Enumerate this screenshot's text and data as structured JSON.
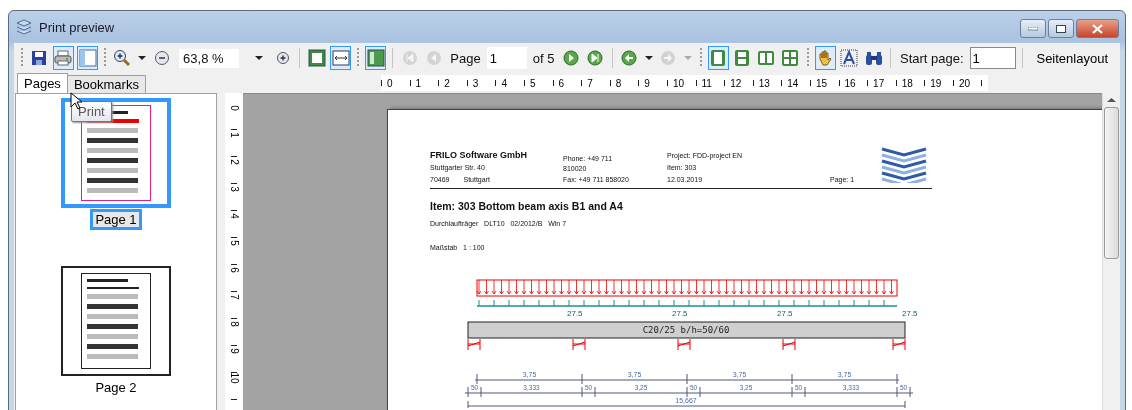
{
  "window": {
    "title": "Print preview"
  },
  "toolbar": [
    {
      "kind": "grip"
    },
    {
      "kind": "button",
      "selected": false,
      "disabled": false
    },
    {
      "kind": "button",
      "selected": true,
      "disabled": false
    },
    {
      "kind": "button",
      "selected": true,
      "disabled": false
    },
    {
      "kind": "grip"
    },
    {
      "kind": "button",
      "selected": false,
      "disabled": false
    },
    {
      "kind": "caret",
      "disabled": false
    },
    {
      "kind": "button",
      "selected": false,
      "disabled": false
    },
    {
      "kind": "combo",
      "value": "63,8 %"
    },
    {
      "kind": "button",
      "selected": false,
      "disabled": false
    },
    {
      "kind": "sep"
    },
    {
      "kind": "button",
      "selected": false,
      "disabled": false
    },
    {
      "kind": "button",
      "selected": true,
      "disabled": false
    },
    {
      "kind": "grip"
    },
    {
      "kind": "button",
      "selected": true,
      "disabled": false
    },
    {
      "kind": "sep"
    },
    {
      "kind": "button",
      "selected": false,
      "disabled": true
    },
    {
      "kind": "button",
      "selected": false,
      "disabled": true
    },
    {
      "kind": "label",
      "text": "Page"
    },
    {
      "kind": "input",
      "value": "1"
    },
    {
      "kind": "label",
      "text": "of 5"
    },
    {
      "kind": "button",
      "selected": false,
      "disabled": false
    },
    {
      "kind": "button",
      "selected": false,
      "disabled": false
    },
    {
      "kind": "sep"
    },
    {
      "kind": "button",
      "selected": false,
      "disabled": false
    },
    {
      "kind": "caret",
      "disabled": false
    },
    {
      "kind": "button",
      "selected": false,
      "disabled": true
    },
    {
      "kind": "caret",
      "disabled": true
    },
    {
      "kind": "grip"
    },
    {
      "kind": "button",
      "selected": true,
      "disabled": false
    },
    {
      "kind": "button",
      "selected": false,
      "disabled": false
    },
    {
      "kind": "button",
      "selected": false,
      "disabled": false
    },
    {
      "kind": "button",
      "selected": false,
      "disabled": false
    },
    {
      "kind": "grip"
    },
    {
      "kind": "button",
      "selected": true,
      "disabled": false
    },
    {
      "kind": "button",
      "selected": false,
      "disabled": false
    },
    {
      "kind": "button",
      "selected": false,
      "disabled": false
    },
    {
      "kind": "sep"
    },
    {
      "kind": "label",
      "text": "Start page:"
    },
    {
      "kind": "input",
      "value": "1"
    },
    {
      "kind": "sep"
    },
    {
      "kind": "text_button",
      "text": "Seitenlayout"
    }
  ],
  "tabs": [
    {
      "label": "Pages",
      "selected": true
    },
    {
      "label": "Bookmarks",
      "selected": false
    }
  ],
  "tooltip": "Print",
  "thumbnails": [
    {
      "label": "Page 1",
      "selected": true
    },
    {
      "label": "Page 2",
      "selected": false
    }
  ],
  "ruler_horizontal": [
    "0",
    "1",
    "2",
    "3",
    "4",
    "5",
    "6",
    "7",
    "8",
    "9",
    "10",
    "11",
    "12",
    "13",
    "14",
    "15",
    "16",
    "17",
    "18",
    "19",
    "20"
  ],
  "ruler_vertical": [
    "0",
    "1",
    "2",
    "3",
    "4",
    "5",
    "6",
    "7",
    "8",
    "9",
    "10"
  ],
  "document": {
    "company": "FRILO Software GmbH",
    "street": "Stuttgarter Str. 40",
    "zip": "70469",
    "city": "Stuttgart",
    "phone": "Phone: +49 711 810020",
    "fax": "Fax: +49 711 858020",
    "project": "Project: FDD-project EN",
    "item": "Item: 303",
    "date": "12.03.2019",
    "page": "Page: 1",
    "title": "Item: 303  Bottom beam axis B1 and A4",
    "subtitle": "Durchlaufträger   DLT10   02/2012/B   Win 7",
    "scale": "Maßstab   1 : 100",
    "load_labels": [
      "27.5",
      "27.5",
      "27.5",
      "27.5"
    ],
    "beam_label": "C20/25  b/h=50/60",
    "spans": [
      "3,75",
      "3,75",
      "3,75",
      "3,75"
    ],
    "segments": [
      "50",
      "3,333",
      "50",
      "3,25",
      "50",
      "3,25",
      "50",
      "3,333",
      "50"
    ],
    "total": "15,667"
  }
}
